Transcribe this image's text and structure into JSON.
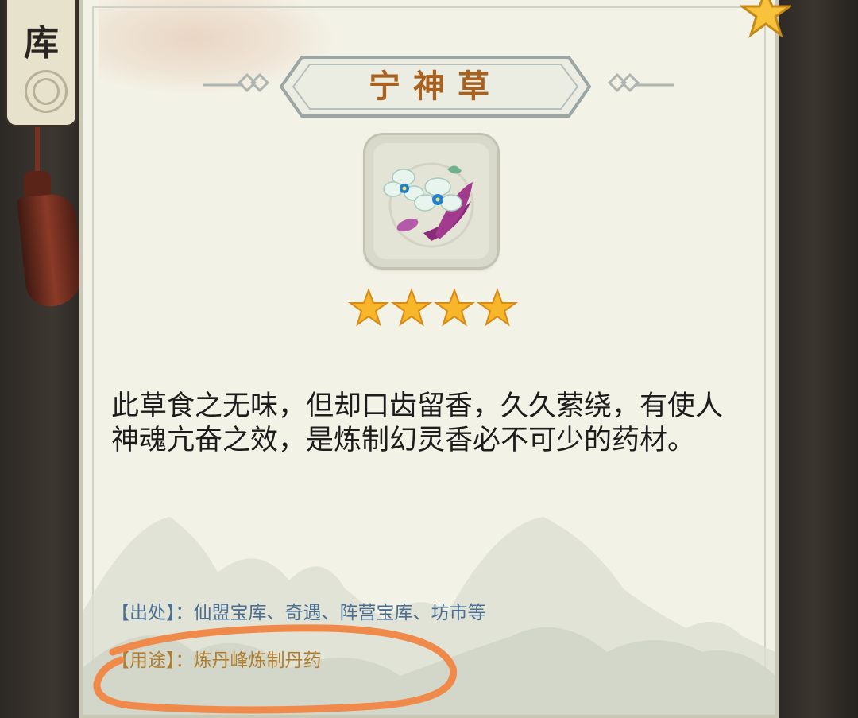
{
  "side_panel": {
    "plaque_text": "库"
  },
  "item": {
    "title": "宁神草",
    "icon": "orchid-flower-icon",
    "stars": 4,
    "description": "此草食之无味，但却口齿留香，久久萦绕，有使人神魂亢奋之效，是炼制幻灵香必不可少的药材。",
    "source_label": "【出处】：",
    "source_value": "仙盟宝库、奇遇、阵营宝库、坊市等",
    "use_label": "【用途】：",
    "use_value": "炼丹峰炼制丹药"
  },
  "colors": {
    "title": "#a8611e",
    "source": "#4a6f93",
    "use": "#b07d2e",
    "annotation": "#f08a4b",
    "card_bg": "#f3f2e6"
  }
}
